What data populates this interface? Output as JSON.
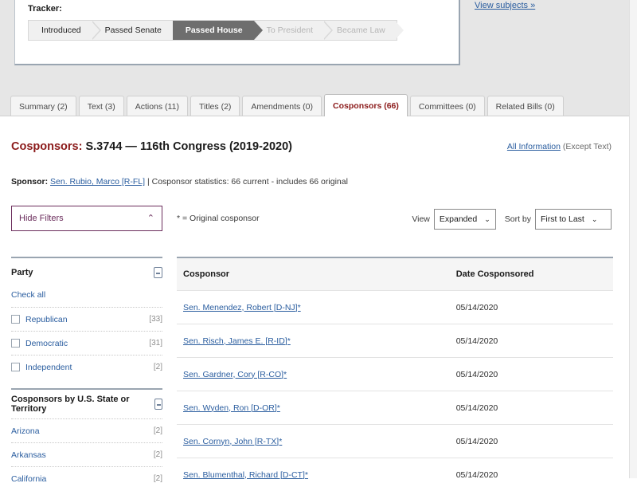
{
  "top": {
    "view_subjects_label": "View subjects »",
    "tracker": {
      "label": "Tracker:",
      "steps": [
        {
          "label": "Introduced",
          "state": "done"
        },
        {
          "label": "Passed Senate",
          "state": "done"
        },
        {
          "label": "Passed House",
          "state": "current"
        },
        {
          "label": "To President",
          "state": "future"
        },
        {
          "label": "Became Law",
          "state": "future"
        }
      ]
    }
  },
  "tabs": [
    {
      "label": "Summary (2)",
      "active": false
    },
    {
      "label": "Text (3)",
      "active": false
    },
    {
      "label": "Actions (11)",
      "active": false
    },
    {
      "label": "Titles (2)",
      "active": false
    },
    {
      "label": "Amendments (0)",
      "active": false
    },
    {
      "label": "Cosponsors (66)",
      "active": true
    },
    {
      "label": "Committees (0)",
      "active": false
    },
    {
      "label": "Related Bills (0)",
      "active": false
    }
  ],
  "header": {
    "title_accent": "Cosponsors:",
    "title_rest": " S.3744 — 116th Congress (2019-2020)",
    "all_information_link": "All Information",
    "all_information_suffix": " (Except Text)"
  },
  "sponsor": {
    "label": "Sponsor:",
    "link": "Sen. Rubio, Marco [R-FL]",
    "stats": " | Cosponsor statistics: 66 current - includes 66 original"
  },
  "controls": {
    "hide_filters_label": "Hide Filters",
    "hide_filters_caret": "⌃",
    "original_note": "* = Original cosponsor",
    "view_label": "View",
    "view_value": "Expanded",
    "sort_label": "Sort by",
    "sort_value": "First to Last",
    "caret": "⌄"
  },
  "facets": {
    "party": {
      "title": "Party",
      "check_all": "Check all",
      "rows": [
        {
          "label": "Republican",
          "count": "[33]"
        },
        {
          "label": "Democratic",
          "count": "[31]"
        },
        {
          "label": "Independent",
          "count": "[2]"
        }
      ]
    },
    "states": {
      "title": "Cosponsors by U.S. State or Territory",
      "rows": [
        {
          "label": "Arizona",
          "count": "[2]"
        },
        {
          "label": "Arkansas",
          "count": "[2]"
        },
        {
          "label": "California",
          "count": "[2]"
        }
      ]
    }
  },
  "table": {
    "columns": [
      "Cosponsor",
      "Date Cosponsored"
    ],
    "rows": [
      {
        "cosponsor": "Sen. Menendez, Robert [D-NJ]*",
        "date": "05/14/2020"
      },
      {
        "cosponsor": "Sen. Risch, James E. [R-ID]*",
        "date": "05/14/2020"
      },
      {
        "cosponsor": "Sen. Gardner, Cory [R-CO]*",
        "date": "05/14/2020"
      },
      {
        "cosponsor": "Sen. Wyden, Ron [D-OR]*",
        "date": "05/14/2020"
      },
      {
        "cosponsor": "Sen. Cornyn, John [R-TX]*",
        "date": "05/14/2020"
      },
      {
        "cosponsor": "Sen. Blumenthal, Richard [D-CT]*",
        "date": "05/14/2020"
      }
    ]
  }
}
